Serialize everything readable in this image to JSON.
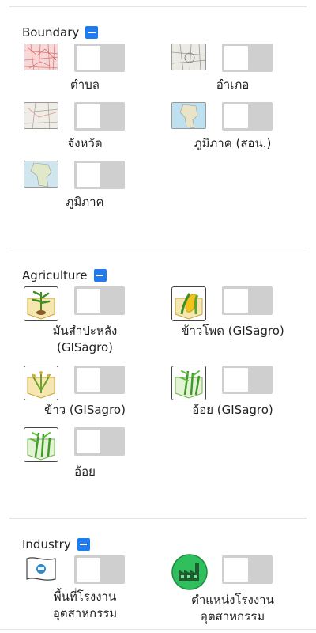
{
  "sections": {
    "boundary": {
      "title": "Boundary",
      "layers": [
        {
          "label": "ตำบล",
          "icon": "subdistrict-map-thumbnail",
          "enabled": false
        },
        {
          "label": "อำเภอ",
          "icon": "district-map-thumbnail",
          "enabled": false
        },
        {
          "label": "จังหวัด",
          "icon": "province-map-thumbnail",
          "enabled": false
        },
        {
          "label": "ภูมิภาค (สอน.)",
          "icon": "region-ocsb-map-thumbnail",
          "enabled": false
        },
        {
          "label": "ภูมิภาค",
          "icon": "region-map-thumbnail",
          "enabled": false
        }
      ]
    },
    "agriculture": {
      "title": "Agriculture",
      "layers": [
        {
          "label": "มันสำปะหลัง\n(GISagro)",
          "icon": "cassava-icon",
          "enabled": false
        },
        {
          "label": "ข้าวโพด (GISagro)",
          "icon": "corn-icon",
          "enabled": false
        },
        {
          "label": "ข้าว (GISagro)",
          "icon": "rice-icon",
          "enabled": false
        },
        {
          "label": "อ้อย (GISagro)",
          "icon": "sugarcane-icon",
          "enabled": false
        },
        {
          "label": "อ้อย",
          "icon": "sugarcane-field-icon",
          "enabled": false
        }
      ]
    },
    "industry": {
      "title": "Industry",
      "layers": [
        {
          "label": "พื้นที่โรงงาน\nอุตสาหกรรม",
          "icon": "industrial-area-flag-icon",
          "enabled": false
        },
        {
          "label": "ตำแหน่งโรงงาน\nอุตสาหกรรม",
          "icon": "factory-location-icon",
          "enabled": false
        }
      ]
    }
  },
  "colors": {
    "accent": "#1e7bf0",
    "toggle_off": "#cfcfcf",
    "divider": "#e4e4e4"
  }
}
